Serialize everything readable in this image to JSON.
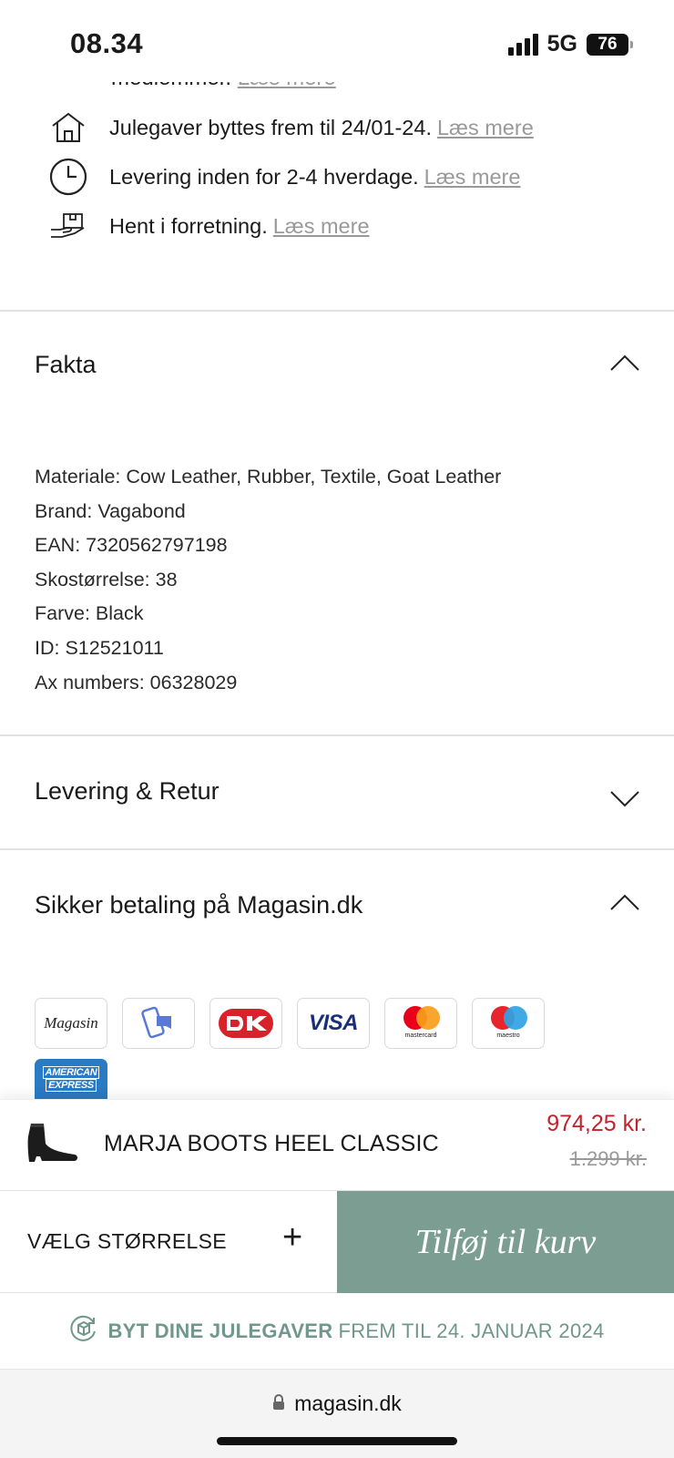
{
  "status_bar": {
    "time": "08.34",
    "network": "5G",
    "battery": "76"
  },
  "perks": {
    "cut_text": "medlemmer.",
    "cut_link": "Læs mere",
    "items": [
      {
        "icon": "house-icon",
        "text": "Julegaver byttes frem til 24/01-24.",
        "link": "Læs mere"
      },
      {
        "icon": "clock-icon",
        "text": "Levering inden for 2-4 hverdage.",
        "link": "Læs mere"
      },
      {
        "icon": "hand-package-icon",
        "text": "Hent i forretning.",
        "link": "Læs mere"
      }
    ]
  },
  "accordions": {
    "fakta": {
      "title": "Fakta",
      "state": "expanded"
    },
    "levering": {
      "title": "Levering & Retur",
      "state": "collapsed"
    },
    "betaling": {
      "title": "Sikker betaling på Magasin.dk",
      "state": "expanded"
    }
  },
  "facts": [
    "Materiale: Cow Leather, Rubber, Textile, Goat Leather",
    "Brand: Vagabond",
    "EAN: 7320562797198",
    "Skostørrelse: 38",
    "Farve: Black",
    "ID: S12521011",
    "Ax numbers: 06328029"
  ],
  "payment_methods": {
    "magasin": "Magasin",
    "mobilepay": "mobilepay-icon",
    "dankort": "dankort-icon",
    "visa": "VISA",
    "mastercard": "mastercard",
    "maestro": "maestro",
    "amex_line1": "AMERICAN",
    "amex_line2": "EXPRESS"
  },
  "product": {
    "name": "MARJA BOOTS HEEL CLASSIC",
    "price_now": "974,25 kr.",
    "price_old": "1.299 kr."
  },
  "actions": {
    "size_label": "VÆLG STØRRELSE",
    "size_plus": "+",
    "add_to_cart": "Tilføj til kurv"
  },
  "banner": {
    "bold": "BYT DINE JULEGAVER",
    "rest": "FREM TIL 24. JANUAR 2024"
  },
  "browser": {
    "url": "magasin.dk"
  },
  "colors": {
    "accent": "#7b9d92",
    "sale": "#c0232b",
    "link": "#999999"
  }
}
